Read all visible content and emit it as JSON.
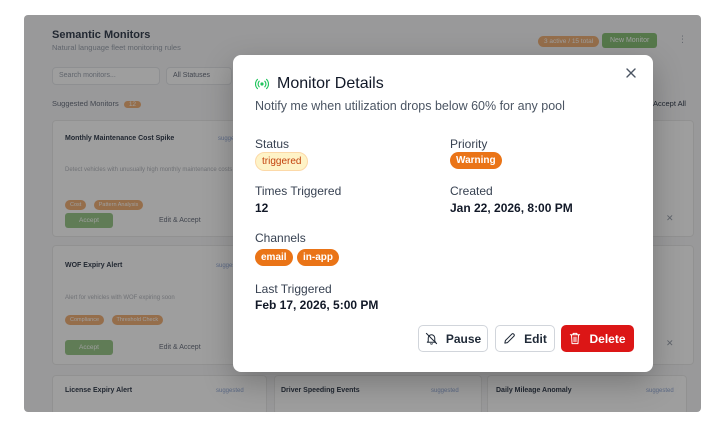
{
  "background": {
    "page_title": "Semantic Monitors",
    "page_subtitle": "Natural language fleet monitoring rules",
    "badge": "3 active / 15 total",
    "new_monitor": "New Monitor",
    "search_placeholder": "Search monitors...",
    "status_filter": "All Statuses",
    "suggested_label": "Suggested Monitors",
    "suggested_count": "12",
    "accept_all": "Accept All",
    "cards": [
      {
        "title": "Monthly Maintenance Cost Spike",
        "tag": "suggested",
        "desc": "Detect vehicles with unusually high monthly maintenance costs",
        "chips": [
          "Cost",
          "Pattern Analysis"
        ],
        "accept": "Accept",
        "edit_accept": "Edit & Accept"
      },
      {
        "title": "WOF Expiry Alert",
        "tag": "suggested",
        "desc": "Alert for vehicles with WOF expiring soon",
        "chips": [
          "Compliance",
          "Threshold Check"
        ],
        "accept": "Accept",
        "edit_accept": "Edit & Accept"
      },
      {
        "title": "License Expiry Alert",
        "tag": "suggested"
      },
      {
        "title": "Driver Speeding Events",
        "tag": "suggested"
      },
      {
        "title": "Daily Mileage Anomaly",
        "tag": "suggested"
      }
    ]
  },
  "modal": {
    "title": "Monitor Details",
    "subtitle": "Notify me when utilization drops below 60% for any pool",
    "status_label": "Status",
    "status_value": "triggered",
    "priority_label": "Priority",
    "priority_value": "Warning",
    "times_label": "Times Triggered",
    "times_value": "12",
    "created_label": "Created",
    "created_value": "Jan 22, 2026, 8:00 PM",
    "channels_label": "Channels",
    "channels": [
      "email",
      "in-app"
    ],
    "last_label": "Last Triggered",
    "last_value": "Feb 17, 2026, 5:00 PM",
    "pause_label": "Pause",
    "edit_label": "Edit",
    "delete_label": "Delete"
  },
  "colors": {
    "accent_green": "#22c55e",
    "warning_orange": "#ea7417",
    "danger_red": "#dc1616"
  },
  "icons": [
    "signal-icon",
    "close-icon",
    "bell-off-icon",
    "pencil-icon",
    "trash-icon"
  ]
}
